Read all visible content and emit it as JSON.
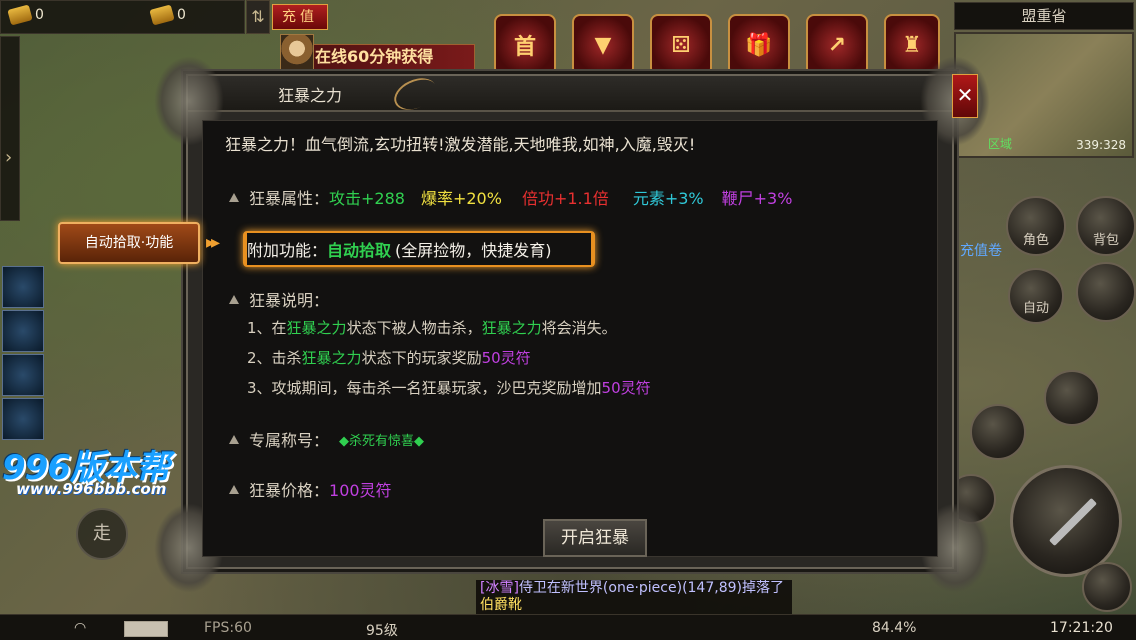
{
  "top_bar": {
    "gold_count": "0",
    "ingot_count": "0",
    "toggle_label": "⇅",
    "recharge_label": "充值",
    "online_reward": "在线60分钟获得"
  },
  "activity_icons": [
    {
      "icon": "首"
    },
    {
      "icon": "▼"
    },
    {
      "icon": "⚄"
    },
    {
      "icon": "🎁"
    },
    {
      "icon": "↗"
    },
    {
      "icon": "♜"
    }
  ],
  "minimap": {
    "region": "盟重省",
    "zone": "区域",
    "coords": "339:328"
  },
  "right_buttons": {
    "recharge_scroll": "充值卷",
    "character": "角色",
    "bag": "背包",
    "auto": "自动"
  },
  "left": {
    "walk": "走",
    "watermark": "996版本帮",
    "watermark_url": "www.996bbb.com"
  },
  "dialog": {
    "title": "狂暴之力",
    "intro": "狂暴之力！血气倒流,玄功扭转!激发潜能,天地唯我,如神,入魔,毁灭!",
    "attr_label": "狂暴属性：",
    "stats": {
      "attack": "攻击+288",
      "crit": "爆率+20%",
      "multiplier": "倍功+1.1倍",
      "element": "元素+3%",
      "corpse": "鞭尸+3%"
    },
    "feature_label": "附加功能：",
    "feature_name": "自动拾取",
    "feature_desc": "(全屏捡物，快捷发育)",
    "desc_label": "狂暴说明：",
    "desc_1_pre": "1、在",
    "desc_1_hl": "狂暴之力",
    "desc_1_mid": "状态下被人物击杀，",
    "desc_1_hl2": "狂暴之力",
    "desc_1_post": "将会消失。",
    "desc_2_pre": "2、击杀",
    "desc_2_hl": "狂暴之力",
    "desc_2_mid": "状态下的玩家奖励",
    "desc_2_reward": "50灵符",
    "desc_3_pre": "3、攻城期间，每击杀一名狂暴玩家，沙巴克奖励增加",
    "desc_3_reward": "50灵符",
    "title_label": "专属称号：",
    "exclusive_title": "◆杀死有惊喜◆",
    "price_label": "狂暴价格：",
    "price": "100灵符",
    "open_button": "开启狂暴"
  },
  "feature_tag": "自动拾取·功能",
  "feature_arrow": "▸▸",
  "close_label": "✕",
  "chat": {
    "channel": "[冰雪]",
    "message_pre": "侍卫在新世界(one·piece)(147,89)掉落了",
    "item": "伯爵靴"
  },
  "bottom_bar": {
    "fps": "FPS:60",
    "level": "95级",
    "exp": "84.4%",
    "time": "17:21:20"
  }
}
